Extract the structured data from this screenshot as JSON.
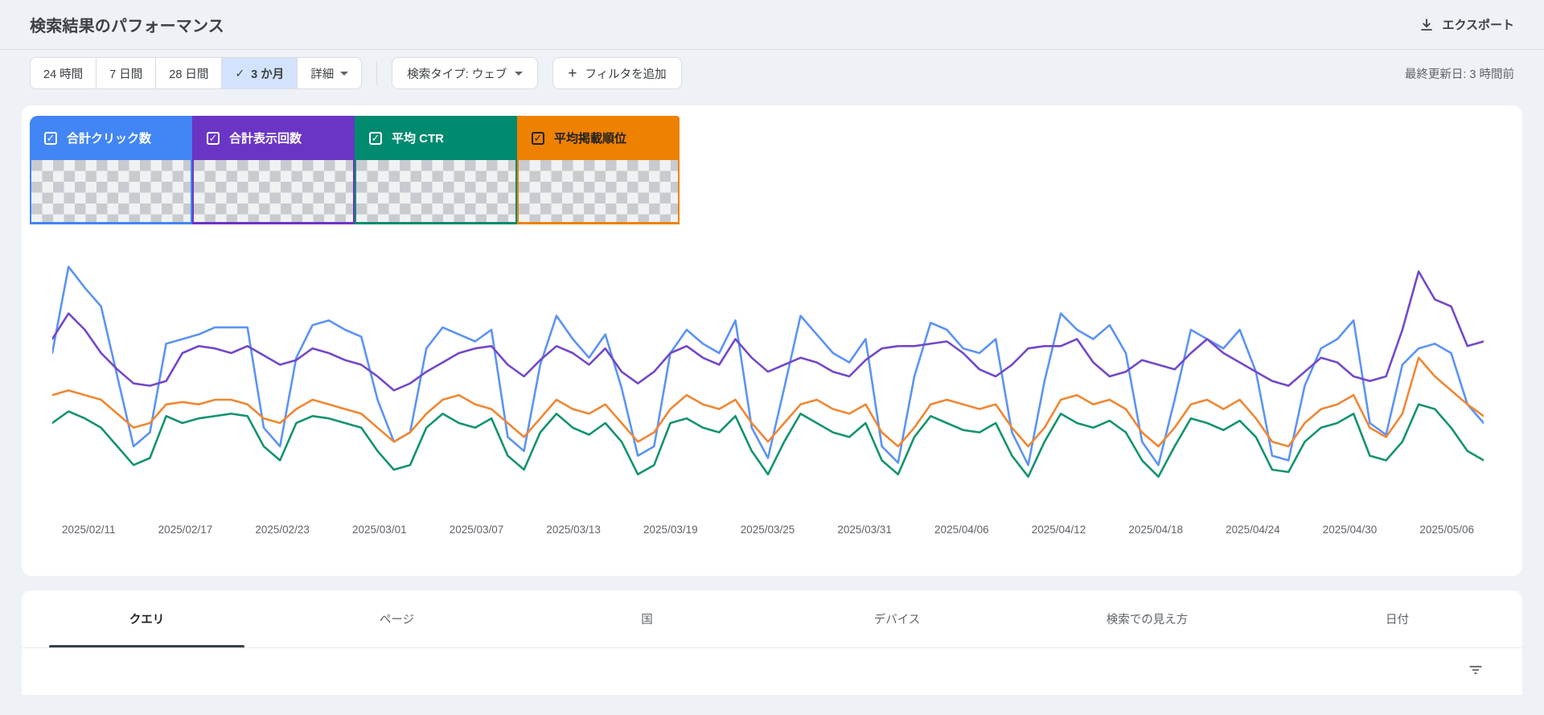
{
  "header": {
    "title": "検索結果のパフォーマンス",
    "export_label": "エクスポート",
    "last_updated": "最終更新日: 3 時間前"
  },
  "filters": {
    "range_24h": "24 時間",
    "range_7d": "7 日間",
    "range_28d": "28 日間",
    "range_3m": "3 か月",
    "active_range": "3 か月",
    "check_glyph": "✓",
    "more_label": "詳細",
    "search_type_label": "検索タイプ: ウェブ",
    "add_filter_label": "フィルタを追加",
    "plus_glyph": "+"
  },
  "metrics": [
    {
      "label": "合計クリック数",
      "color": "#4285f4",
      "text_color": "#ffffff",
      "checked": true,
      "check_glyph": "✓"
    },
    {
      "label": "合計表示回数",
      "color": "#6a35c4",
      "text_color": "#ffffff",
      "checked": true,
      "check_glyph": "✓"
    },
    {
      "label": "平均 CTR",
      "color": "#008a70",
      "text_color": "#ffffff",
      "checked": true,
      "check_glyph": "✓"
    },
    {
      "label": "平均掲載順位",
      "color": "#ee8100",
      "text_color": "#202124",
      "checked": true,
      "check_glyph": "✓"
    }
  ],
  "tabs": [
    {
      "label": "クエリ",
      "active": true
    },
    {
      "label": "ページ",
      "active": false
    },
    {
      "label": "国",
      "active": false
    },
    {
      "label": "デバイス",
      "active": false
    },
    {
      "label": "検索での見え方",
      "active": false
    },
    {
      "label": "日付",
      "active": false
    }
  ],
  "chart_data": {
    "type": "line",
    "x_axis": "date (daily, 2025/02/10 – 2025/05/08)",
    "ticks": [
      "2025/02/11",
      "2025/02/17",
      "2025/02/23",
      "2025/03/01",
      "2025/03/07",
      "2025/03/13",
      "2025/03/19",
      "2025/03/25",
      "2025/03/31",
      "2025/04/06",
      "2025/04/12",
      "2025/04/18",
      "2025/04/24",
      "2025/04/30",
      "2025/05/06"
    ],
    "ylim": [
      0,
      100
    ],
    "grid": false,
    "legend_position": "top-cards",
    "series": [
      {
        "name": "合計クリック数",
        "color": "#5b93f5",
        "values": [
          60,
          97,
          88,
          80,
          50,
          20,
          26,
          64,
          66,
          68,
          71,
          71,
          71,
          28,
          20,
          58,
          72,
          74,
          70,
          67,
          40,
          22,
          26,
          62,
          71,
          68,
          65,
          70,
          24,
          18,
          55,
          76,
          66,
          58,
          68,
          45,
          16,
          20,
          60,
          70,
          64,
          60,
          74,
          28,
          15,
          45,
          76,
          68,
          60,
          56,
          66,
          20,
          13,
          50,
          73,
          70,
          62,
          60,
          66,
          26,
          12,
          48,
          77,
          70,
          66,
          72,
          60,
          22,
          12,
          40,
          70,
          66,
          62,
          70,
          52,
          16,
          14,
          46,
          62,
          66,
          74,
          30,
          25,
          55,
          62,
          64,
          60,
          38,
          30
        ]
      },
      {
        "name": "合計表示回数",
        "color": "#7348c8",
        "values": [
          66,
          77,
          70,
          60,
          53,
          47,
          46,
          48,
          60,
          63,
          62,
          60,
          63,
          59,
          55,
          57,
          62,
          60,
          57,
          55,
          50,
          44,
          47,
          52,
          56,
          60,
          62,
          63,
          55,
          50,
          57,
          63,
          60,
          55,
          62,
          52,
          47,
          52,
          60,
          63,
          58,
          55,
          66,
          58,
          52,
          55,
          58,
          56,
          52,
          50,
          57,
          62,
          63,
          63,
          64,
          65,
          60,
          53,
          50,
          55,
          62,
          63,
          63,
          66,
          56,
          50,
          52,
          57,
          55,
          53,
          60,
          66,
          60,
          56,
          52,
          48,
          46,
          52,
          58,
          56,
          50,
          48,
          50,
          70,
          95,
          83,
          80,
          63,
          65
        ]
      },
      {
        "name": "平均 CTR",
        "color": "#149370",
        "values": [
          30,
          35,
          32,
          28,
          20,
          12,
          15,
          33,
          30,
          32,
          33,
          34,
          33,
          20,
          14,
          30,
          33,
          32,
          30,
          28,
          18,
          10,
          12,
          28,
          34,
          30,
          28,
          32,
          16,
          10,
          26,
          34,
          28,
          25,
          30,
          22,
          8,
          12,
          30,
          32,
          28,
          26,
          33,
          18,
          8,
          22,
          34,
          30,
          26,
          24,
          30,
          14,
          8,
          24,
          33,
          30,
          27,
          26,
          30,
          16,
          7,
          22,
          34,
          30,
          28,
          31,
          26,
          14,
          7,
          20,
          32,
          30,
          27,
          31,
          24,
          10,
          9,
          22,
          28,
          30,
          34,
          16,
          14,
          22,
          38,
          36,
          28,
          18,
          14
        ]
      },
      {
        "name": "平均掲載順位",
        "color": "#ef8733",
        "values": [
          42,
          44,
          42,
          40,
          34,
          28,
          30,
          38,
          39,
          38,
          40,
          40,
          38,
          32,
          30,
          36,
          40,
          38,
          36,
          34,
          28,
          22,
          26,
          34,
          40,
          42,
          38,
          36,
          30,
          24,
          32,
          40,
          36,
          34,
          38,
          30,
          22,
          26,
          36,
          42,
          38,
          36,
          40,
          30,
          22,
          30,
          38,
          40,
          36,
          34,
          38,
          26,
          20,
          28,
          38,
          40,
          38,
          36,
          38,
          28,
          20,
          28,
          40,
          42,
          38,
          40,
          36,
          26,
          20,
          28,
          38,
          40,
          36,
          40,
          32,
          22,
          20,
          30,
          36,
          38,
          42,
          28,
          24,
          34,
          58,
          50,
          44,
          38,
          33
        ]
      }
    ]
  }
}
